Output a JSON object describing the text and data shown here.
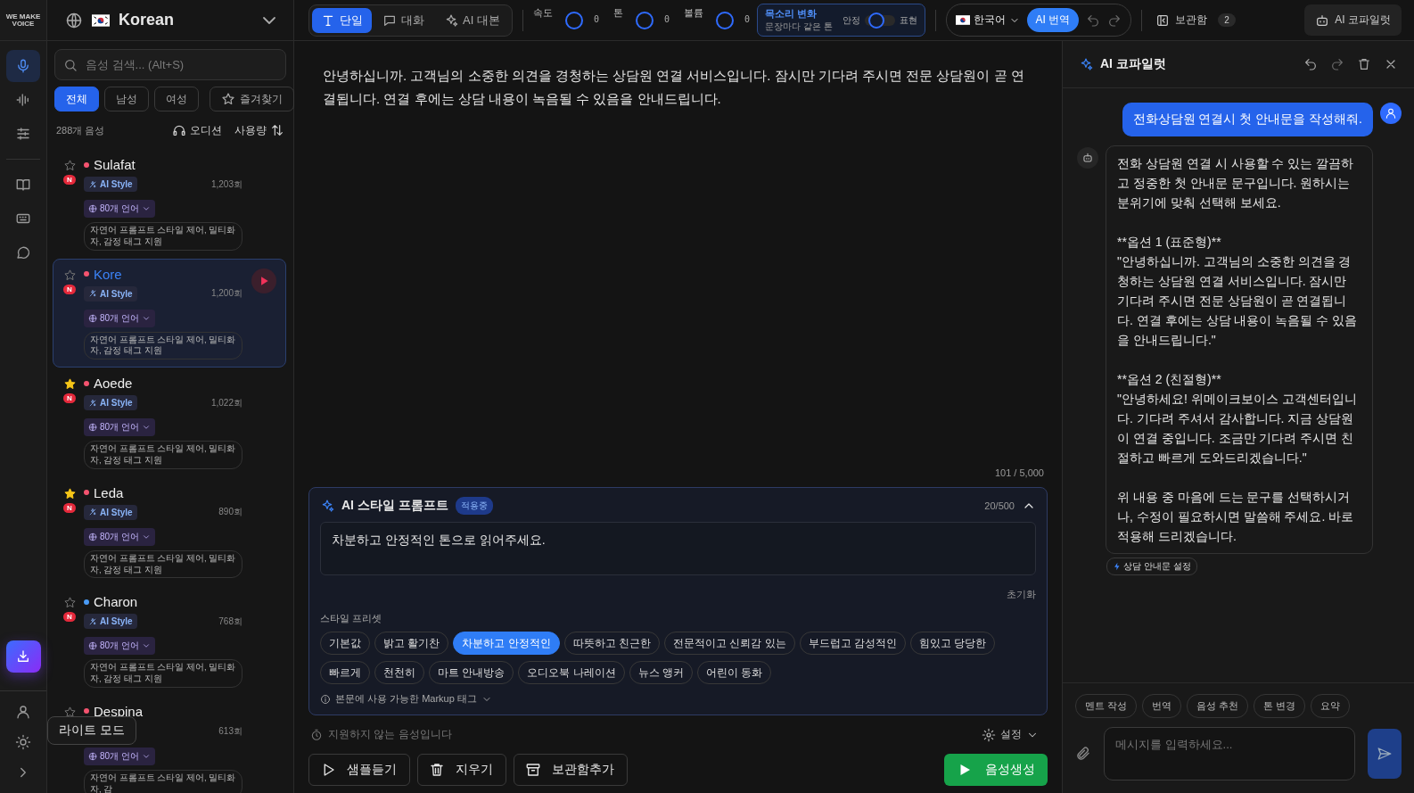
{
  "logo": "WE MAKE VOICE",
  "language_selector": {
    "label": "Korean"
  },
  "rail": [
    {
      "selected": true
    },
    {
      "selected": false
    },
    {
      "selected": false
    },
    {
      "selected": false
    },
    {
      "selected": false
    },
    {
      "selected": false
    }
  ],
  "search": {
    "placeholder": "음성 검색... (Alt+S)"
  },
  "filters": [
    {
      "label": "전체",
      "selected": true
    },
    {
      "label": "남성",
      "selected": false
    },
    {
      "label": "여성",
      "selected": false
    }
  ],
  "favorites_button": "즐겨찾기",
  "voice_count": "288개 음성",
  "audition_button": "오디션",
  "sort_button": "사용량",
  "voices": [
    {
      "name": "Sulafat",
      "starred": false,
      "color": "#f4536f",
      "new_badge": "N",
      "style_badge": "AI Style",
      "uses": "1,203회",
      "languages": "80개 언어",
      "description": "자연어 프롬프트 스타일 제어, 밀티화자, 감정 태그 지원",
      "selected": false
    },
    {
      "name": "Kore",
      "starred": false,
      "color": "#f4536f",
      "new_badge": "N",
      "style_badge": "AI Style",
      "uses": "1,200회",
      "languages": "80개 언어",
      "description": "자연어 프롬프트 스타일 제어, 밀티화자, 감정 태그 지원",
      "selected": true
    },
    {
      "name": "Aoede",
      "starred": true,
      "color": "#f4536f",
      "new_badge": "N",
      "style_badge": "AI Style",
      "uses": "1,022회",
      "languages": "80개 언어",
      "description": "자연어 프롬프트 스타일 제어, 밀티화자, 감정 태그 지원",
      "selected": false
    },
    {
      "name": "Leda",
      "starred": true,
      "color": "#f4536f",
      "new_badge": "N",
      "style_badge": "AI Style",
      "uses": "890회",
      "languages": "80개 언어",
      "description": "자연어 프롬프트 스타일 제어, 밀티화자, 감정 태그 지원",
      "selected": false
    },
    {
      "name": "Charon",
      "starred": false,
      "color": "#4a9bf5",
      "new_badge": "N",
      "style_badge": "AI Style",
      "uses": "768회",
      "languages": "80개 언어",
      "description": "자연어 프롬프트 스타일 제어, 밀티화자, 감정 태그 지원",
      "selected": false
    },
    {
      "name": "Despina",
      "starred": false,
      "color": "#f4536f",
      "uses": "613회",
      "languages": "80개 언어",
      "description": "자연어 프롬프트 스타일 제어, 밀티화자, 감",
      "selected": false
    }
  ],
  "tooltip": "라이트 모드",
  "toolbar": {
    "modes": [
      {
        "label": "단일",
        "selected": true
      },
      {
        "label": "대화",
        "selected": false
      },
      {
        "label": "AI 대본",
        "selected": false
      }
    ],
    "sliders": [
      {
        "label": "속도",
        "value": "0"
      },
      {
        "label": "톤",
        "value": "0"
      },
      {
        "label": "볼륨",
        "value": "0"
      }
    ],
    "voice_change": {
      "title": "목소리 변화",
      "subtitle": "문장마다 같은 톤",
      "left_label": "안정",
      "right_label": "표현",
      "on": false
    },
    "language": "한국어",
    "translate_button": "AI 번역",
    "storage": {
      "label": "보관함",
      "count": "2"
    },
    "copilot_button": "AI 코파일럿"
  },
  "editor": {
    "text": "안녕하십니까. 고객님의 소중한 의견을 경청하는 상담원 연결 서비스입니다. 잠시만 기다려 주시면 전문 상담원이 곧 연결됩니다. 연결 후에는 상담 내용이 녹음될 수 있음을 안내드립니다.",
    "counter": "101 / 5,000"
  },
  "style_prompt": {
    "title": "AI 스타일 프롬프트",
    "badge": "적용중",
    "counter": "20/500",
    "expanded": true,
    "value": "차분하고 안정적인 톤으로 읽어주세요.",
    "reset": "초기화",
    "presets_label": "스타일 프리셋",
    "presets": [
      {
        "label": "기본값",
        "selected": false
      },
      {
        "label": "밝고 활기찬",
        "selected": false
      },
      {
        "label": "차분하고 안정적인",
        "selected": true
      },
      {
        "label": "따뜻하고 친근한",
        "selected": false
      },
      {
        "label": "전문적이고 신뢰감 있는",
        "selected": false
      },
      {
        "label": "부드럽고 감성적인",
        "selected": false
      },
      {
        "label": "힘있고 당당한",
        "selected": false
      },
      {
        "label": "빠르게",
        "selected": false
      },
      {
        "label": "천천히",
        "selected": false
      },
      {
        "label": "마트 안내방송",
        "selected": false
      },
      {
        "label": "오디오북 나레이션",
        "selected": false
      },
      {
        "label": "뉴스 앵커",
        "selected": false
      },
      {
        "label": "어린이 동화",
        "selected": false
      }
    ],
    "markup_hint": "본문에 사용 가능한 Markup 태그"
  },
  "notice": "지원하지 않는 음성입니다",
  "settings": "설정",
  "actions": [
    "샘플듣기",
    "지우기",
    "보관함추가"
  ],
  "generate_button": "음성생성",
  "copilot": {
    "title": "AI 코파일럿",
    "messages": [
      {
        "kind": "user",
        "paragraphs": [
          "전화상담원 연결시 첫 안내문을 작성해줘."
        ]
      },
      {
        "kind": "assistant",
        "paragraphs": [
          "전화 상담원 연결 시 사용할 수 있는 깔끔하고 정중한 첫 안내문 문구입니다. 원하시는 분위기에 맞춰 선택해 보세요.",
          "**옵션 1 (표준형)**\n\"안녕하십니까. 고객님의 소중한 의견을 경청하는 상담원 연결 서비스입니다. 잠시만 기다려 주시면 전문 상담원이 곧 연결됩니다. 연결 후에는 상담 내용이 녹음될 수 있음을 안내드립니다.\"",
          "**옵션 2 (친절형)**\n\"안녕하세요! 위메이크보이스 고객센터입니다. 기다려 주셔서 감사합니다. 지금 상담원이 연결 중입니다. 조금만 기다려 주시면 친절하고 빠르게 도와드리겠습니다.\"",
          "위 내용 중 마음에 드는 문구를 선택하시거나, 수정이 필요하시면 말씀해 주세요. 바로 적용해 드리겠습니다."
        ]
      }
    ],
    "chip": "상담 안내문 설정",
    "quick_actions": [
      "멘트 작성",
      "번역",
      "음성 추천",
      "톤 변경",
      "요약"
    ],
    "input": {
      "placeholder": "메시지를 입력하세요..."
    }
  }
}
